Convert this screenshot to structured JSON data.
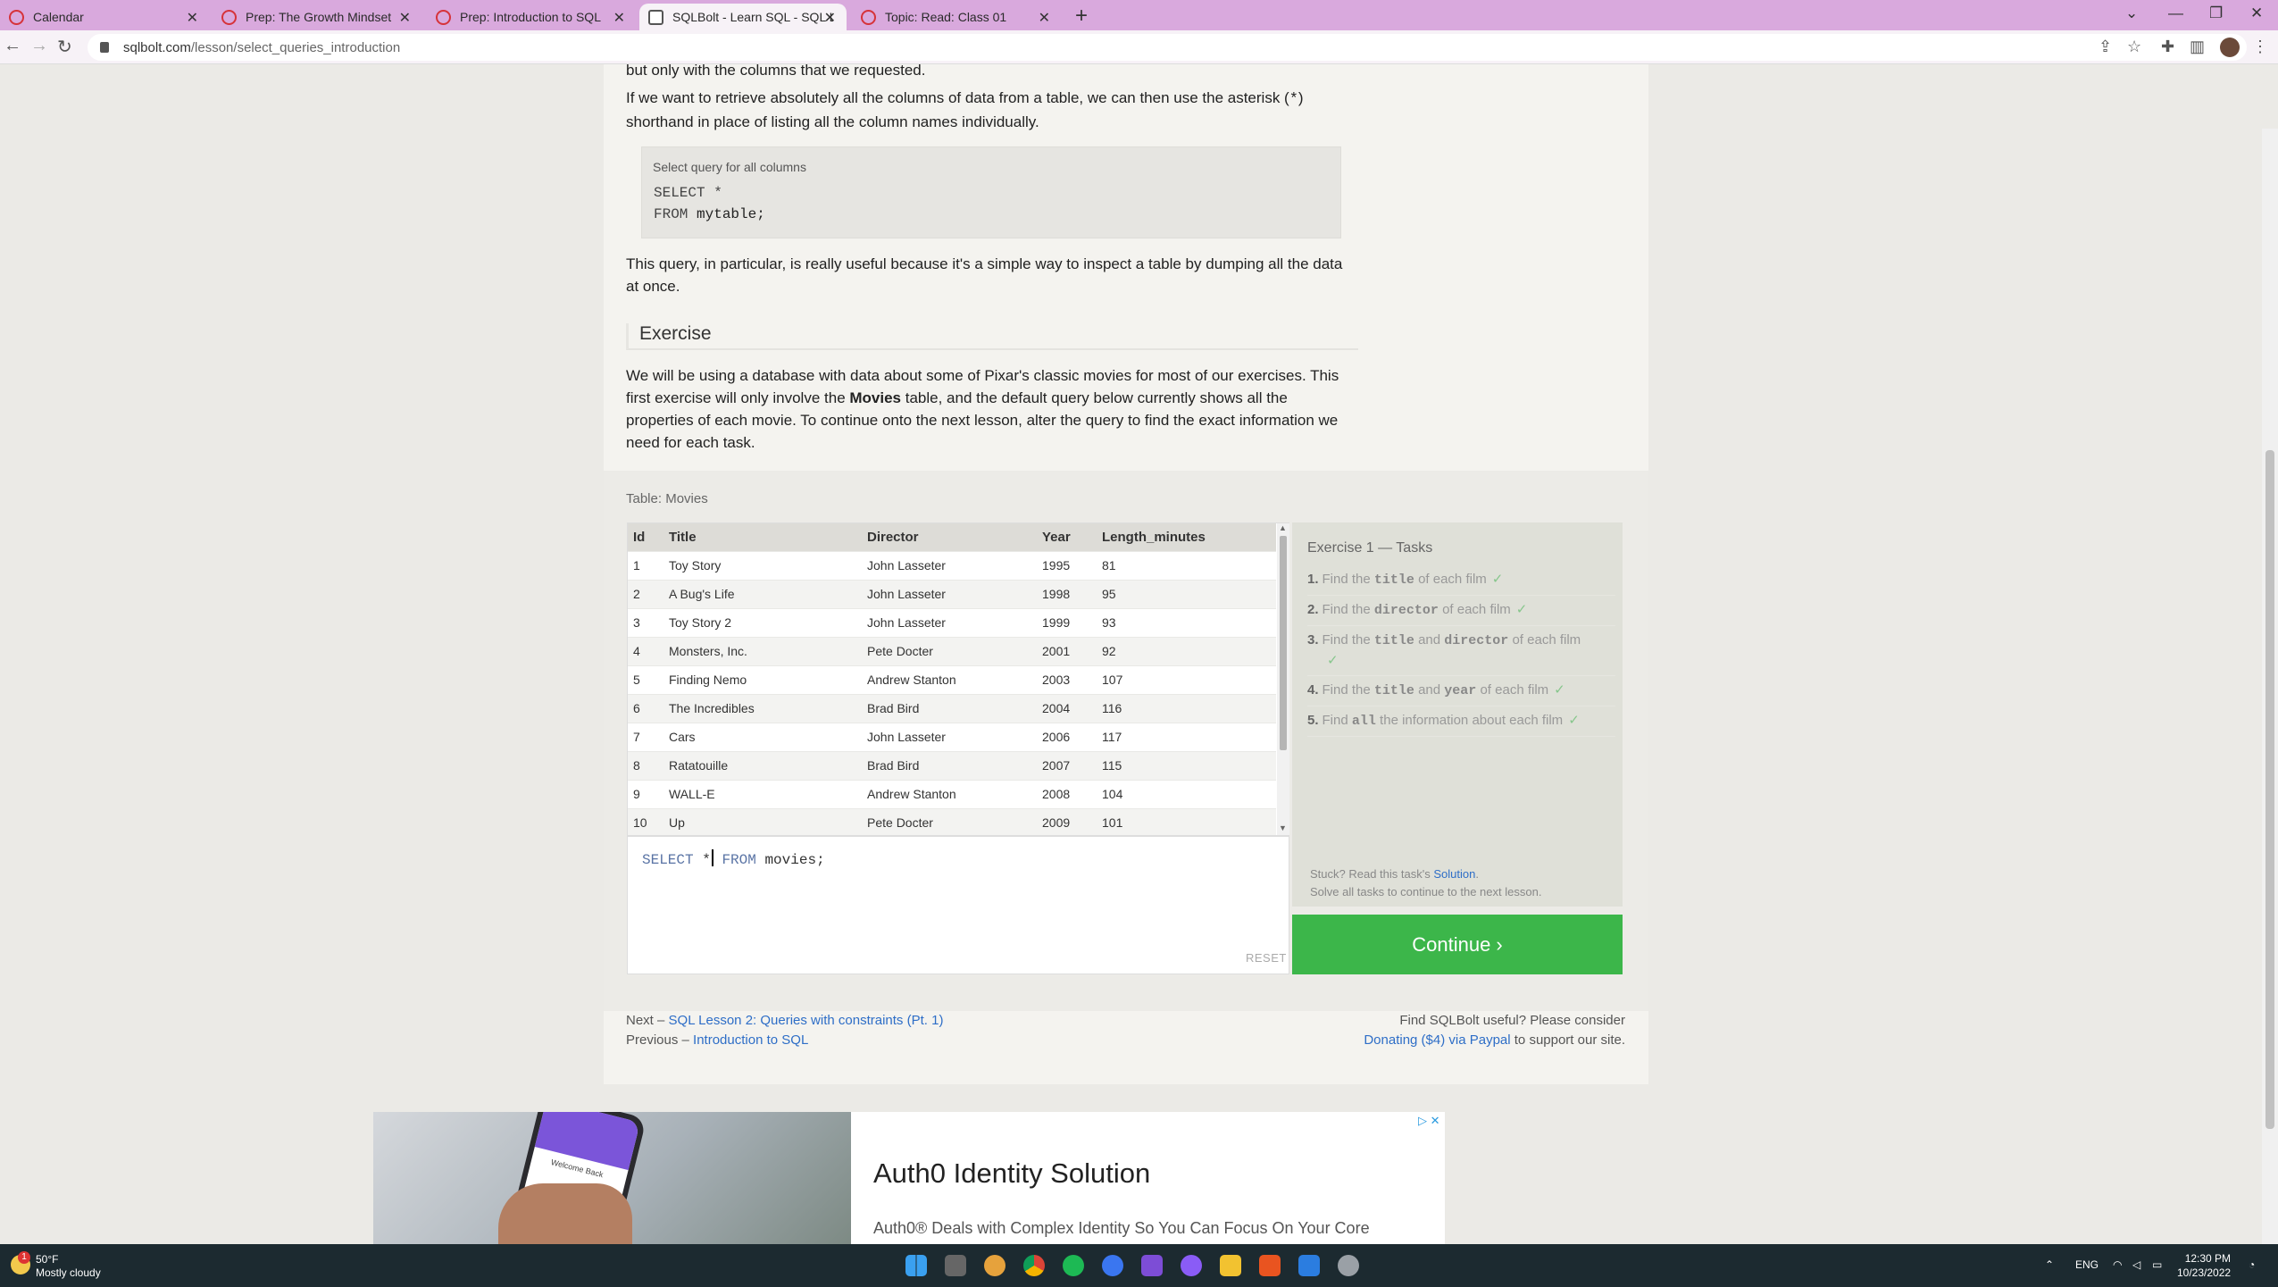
{
  "browser": {
    "tabs": [
      {
        "label": "Calendar"
      },
      {
        "label": "Prep: The Growth Mindset"
      },
      {
        "label": "Prep: Introduction to SQL"
      },
      {
        "label": "SQLBolt - Learn SQL - SQL Lesso"
      },
      {
        "label": "Topic: Read: Class 01"
      }
    ],
    "url_host": "sqlbolt.com",
    "url_path": "/lesson/select_queries_introduction"
  },
  "lesson": {
    "intro_tail": "but only with the columns that we requested.",
    "para1_a": "If we want to retrieve absolutely all the columns of data from a table, we can then use the asterisk (",
    "para1_code": "*",
    "para1_b": ")",
    "para1_c": "shorthand in place of listing all the column names individually.",
    "codebox": {
      "caption": "Select query for all columns",
      "line1": "SELECT *",
      "line2_kw": "FROM",
      "line2_val": "mytable;"
    },
    "para2": "This query, in particular, is really useful because it's a simple way to inspect a table by dumping all the data",
    "para2b": "at once.",
    "exercise_heading": "Exercise",
    "ex_line1": "We will be using a database with data about some of Pixar's classic movies for most of our exercises. This",
    "ex_line2a": "first exercise will only involve the ",
    "ex_line2_bold": "Movies",
    "ex_line2b": " table, and the default query below currently shows all the",
    "ex_line3": "properties of each movie. To continue onto the next lesson, alter the query to find the exact information we",
    "ex_line4": "need for each task."
  },
  "table": {
    "caption": "Table: Movies",
    "headers": [
      "Id",
      "Title",
      "Director",
      "Year",
      "Length_minutes"
    ],
    "rows": [
      [
        "1",
        "Toy Story",
        "John Lasseter",
        "1995",
        "81"
      ],
      [
        "2",
        "A Bug's Life",
        "John Lasseter",
        "1998",
        "95"
      ],
      [
        "3",
        "Toy Story 2",
        "John Lasseter",
        "1999",
        "93"
      ],
      [
        "4",
        "Monsters, Inc.",
        "Pete Docter",
        "2001",
        "92"
      ],
      [
        "5",
        "Finding Nemo",
        "Andrew Stanton",
        "2003",
        "107"
      ],
      [
        "6",
        "The Incredibles",
        "Brad Bird",
        "2004",
        "116"
      ],
      [
        "7",
        "Cars",
        "John Lasseter",
        "2006",
        "117"
      ],
      [
        "8",
        "Ratatouille",
        "Brad Bird",
        "2007",
        "115"
      ],
      [
        "9",
        "WALL-E",
        "Andrew Stanton",
        "2008",
        "104"
      ],
      [
        "10",
        "Up",
        "Pete Docter",
        "2009",
        "101"
      ]
    ]
  },
  "editor": {
    "kw1": "SELECT",
    "star": "*",
    "kw2": "FROM",
    "rest": "movies;",
    "reset_label": "RESET"
  },
  "tasks": {
    "title": "Exercise 1 — Tasks",
    "items": [
      {
        "n": "1.",
        "pre": "Find the ",
        "code": "title",
        "post": " of each film",
        "check": "✓"
      },
      {
        "n": "2.",
        "pre": "Find the ",
        "code": "director",
        "post": " of each film",
        "check": "✓"
      },
      {
        "n": "3.",
        "pre": "Find the ",
        "code": "title",
        "mid": " and ",
        "code2": "director",
        "post": " of each film",
        "check": "✓"
      },
      {
        "n": "4.",
        "pre": "Find the ",
        "code": "title",
        "mid": " and ",
        "code2": "year",
        "post": " of each film",
        "check": "✓"
      },
      {
        "n": "5.",
        "pre": "Find ",
        "code": "all",
        "post": " the information about each film",
        "check": "✓"
      }
    ],
    "stuck_pre": "Stuck? Read this task's ",
    "stuck_link": "Solution",
    "stuck_post": ".",
    "solve_all": "Solve all tasks to continue to the next lesson.",
    "continue_label": "Continue ›"
  },
  "footer": {
    "next_label": "Next – ",
    "next_link": "SQL Lesson 2: Queries with constraints (Pt. 1)",
    "prev_label": "Previous – ",
    "prev_link": "Introduction to SQL",
    "useful": "Find SQLBolt useful? Please consider",
    "donate_link": "Donating ($4) via Paypal",
    "donate_post": " to support our site."
  },
  "ad": {
    "headline": "Auth0 Identity Solution",
    "sub": "Auth0® Deals with Complex Identity So You Can Focus On Your Core",
    "screen_text": "Welcome Back"
  },
  "taskbar": {
    "temp": "50°F",
    "weather": "Mostly cloudy",
    "badge": "1",
    "lang": "ENG",
    "time": "12:30 PM",
    "date": "10/23/2022"
  }
}
